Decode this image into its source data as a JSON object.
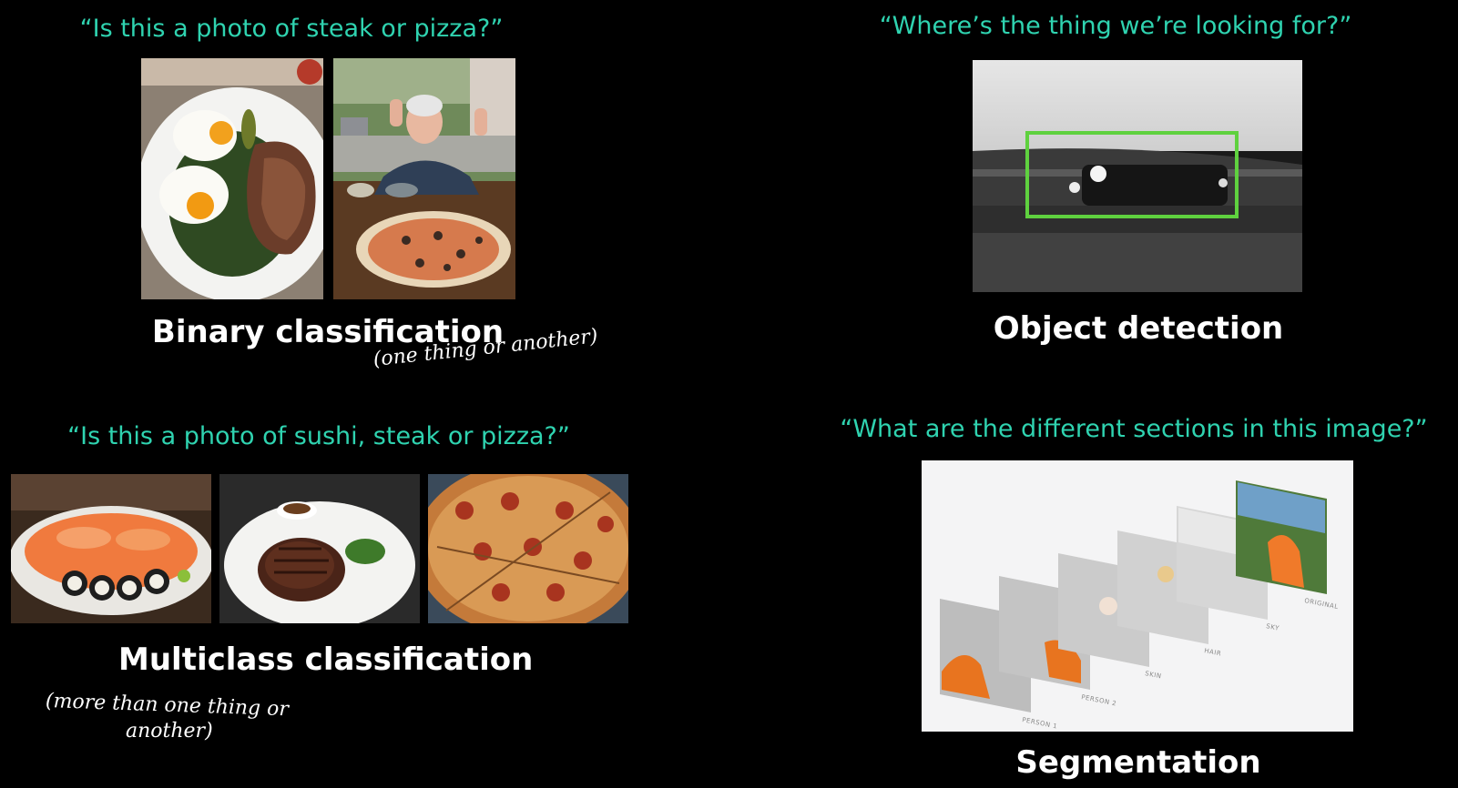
{
  "binary": {
    "question": "“Is this a photo of steak or pizza?”",
    "title": "Binary classification",
    "note": "(one thing or another)"
  },
  "detection": {
    "question": "“Where’s the thing we’re looking for?”",
    "title": "Object detection",
    "box_color": "#5fd13f"
  },
  "multiclass": {
    "question": "“Is this a photo of sushi, steak or pizza?”",
    "title": "Multiclass classification",
    "note_line1": "(more than one thing or",
    "note_line2": "another)"
  },
  "segmentation": {
    "question": "“What are the different sections in this image?”",
    "title": "Segmentation",
    "layers": [
      "PERSON 1",
      "PERSON 2",
      "SKIN",
      "HAIR",
      "SKY",
      "ORIGINAL"
    ]
  },
  "colors": {
    "question_text": "#2fd3b0",
    "title_text": "#ffffff",
    "background": "#000000"
  }
}
